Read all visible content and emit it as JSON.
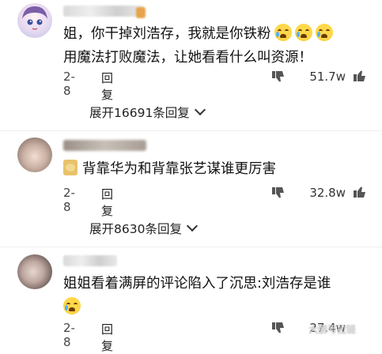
{
  "comments": [
    {
      "text_line1": "姐，你干掉刘浩存，我就是你铁粉",
      "text_line2": "用魔法打败魔法，让她看看什么叫资源！",
      "emoji_icons": [
        "crying-laughing-emoji",
        "crying-laughing-emoji",
        "crying-laughing-emoji"
      ],
      "date": "2-8",
      "reply_label": "回复",
      "likes": "51.7w",
      "expand_label": "展开16691条回复"
    },
    {
      "text_line1": "背靠华为和背靠张艺谋谁更厉害",
      "badge_icon": "cat-sticker-icon",
      "date": "2-8",
      "reply_label": "回复",
      "likes": "32.8w",
      "expand_label": "展开8630条回复"
    },
    {
      "text_line1": "姐姐看着满屏的评论陷入了沉思:刘浩存是谁",
      "emoji_icons": [
        "crying-laughing-emoji"
      ],
      "date": "2-8",
      "reply_label": "回复",
      "likes": "27.4w"
    }
  ],
  "watermark": "大鹏号拉链"
}
